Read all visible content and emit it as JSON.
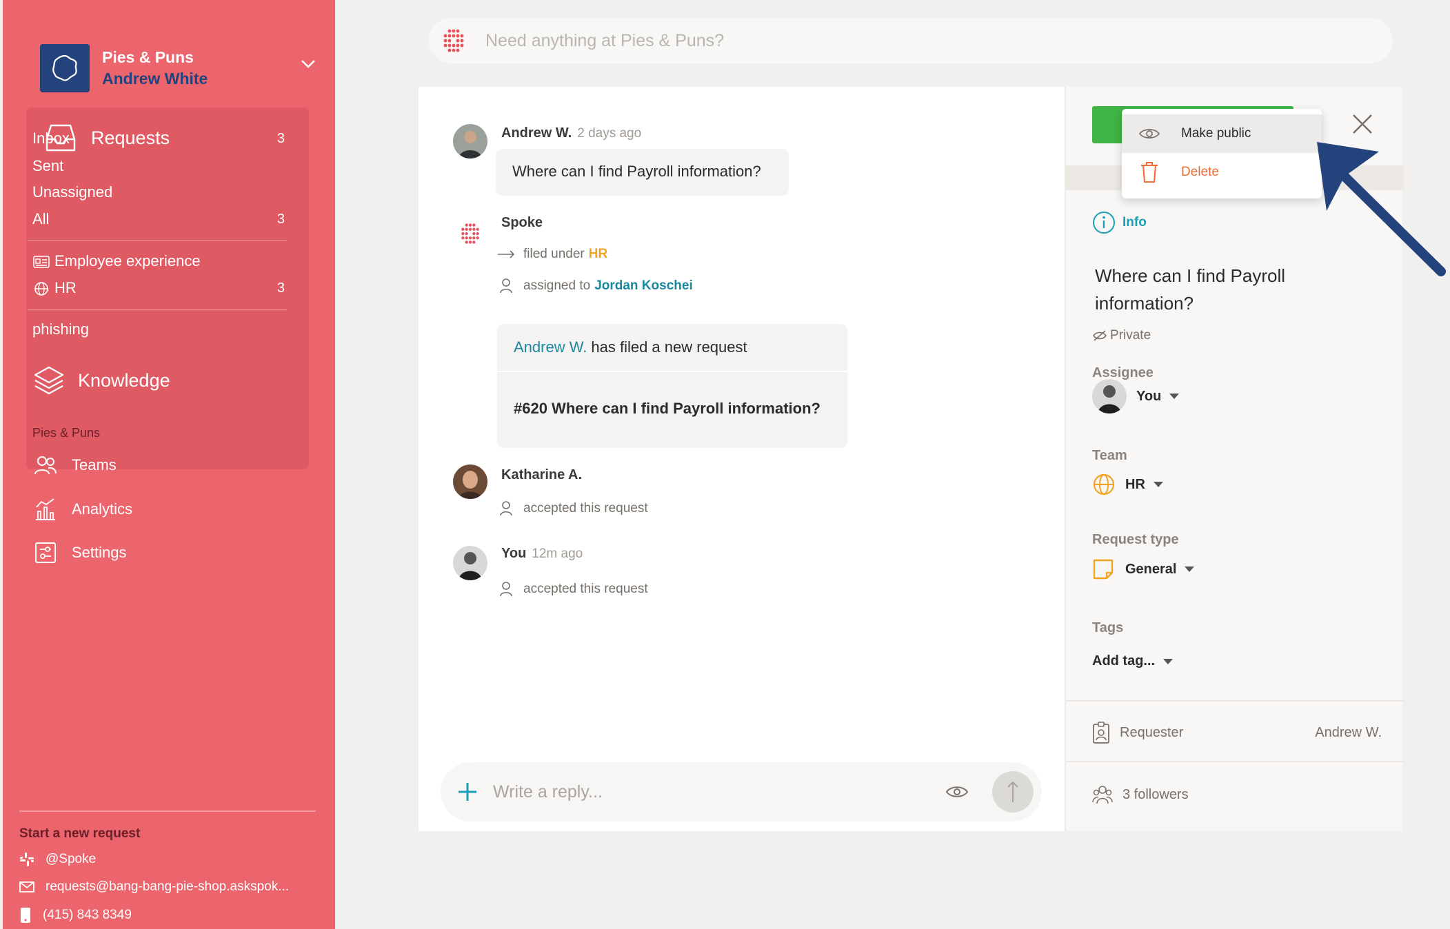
{
  "workspace": {
    "name": "Pies & Puns",
    "user": "Andrew White"
  },
  "sidebar": {
    "requests_label": "Requests",
    "items": [
      {
        "label": "Inbox",
        "count": "3"
      },
      {
        "label": "Sent",
        "count": ""
      },
      {
        "label": "Unassigned",
        "count": ""
      },
      {
        "label": "All",
        "count": "3"
      }
    ],
    "categories": [
      {
        "label": "Employee experience",
        "count": ""
      },
      {
        "label": "HR",
        "count": "3"
      }
    ],
    "extra_item": "phishing",
    "knowledge_label": "Knowledge",
    "section_label": "Pies & Puns",
    "links": [
      {
        "label": "Teams",
        "icon": "teams-icon"
      },
      {
        "label": "Analytics",
        "icon": "analytics-icon"
      },
      {
        "label": "Settings",
        "icon": "settings-icon"
      }
    ],
    "start_label": "Start a new request",
    "contacts": [
      {
        "label": "@Spoke",
        "icon": "slack-icon"
      },
      {
        "label": "requests@bang-bang-pie-shop.askspok...",
        "icon": "mail-icon"
      },
      {
        "label": "(415) 843 8349",
        "icon": "phone-icon"
      }
    ]
  },
  "search": {
    "placeholder": "Need anything at Pies & Puns?"
  },
  "conversation": {
    "msg1": {
      "author": "Andrew W.",
      "ago": "2 days ago",
      "text": "Where can I find Payroll information?"
    },
    "msg2": {
      "author": "Spoke",
      "filed_text": "filed under",
      "filed_team": "HR",
      "assigned_text": "assigned to",
      "assigned_name": "Jordan Koschei",
      "card_author": "Andrew W.",
      "card_action": "has filed a new request",
      "card_title": "#620 Where can I find Payroll information?"
    },
    "msg3": {
      "author": "Katharine A.",
      "event": "accepted this request"
    },
    "msg4": {
      "author": "You",
      "ago": "12m ago",
      "event": "accepted this request"
    },
    "reply_placeholder": "Write a reply..."
  },
  "details": {
    "info_tab": "Info",
    "title": "Where can I find Payroll information?",
    "visibility": "Private",
    "assignee_label": "Assignee",
    "assignee_value": "You",
    "team_label": "Team",
    "team_value": "HR",
    "type_label": "Request type",
    "type_value": "General",
    "tags_label": "Tags",
    "tags_value": "Add tag...",
    "requester_label": "Requester",
    "requester_value": "Andrew W.",
    "followers": "3 followers"
  },
  "menu": {
    "make_public": "Make public",
    "delete": "Delete"
  },
  "colors": {
    "sidebar": "#ec646c",
    "brand_navy": "#24427b",
    "accent_teal": "#1a88a0",
    "green": "#3fb545",
    "delete_orange": "#f06b33"
  }
}
